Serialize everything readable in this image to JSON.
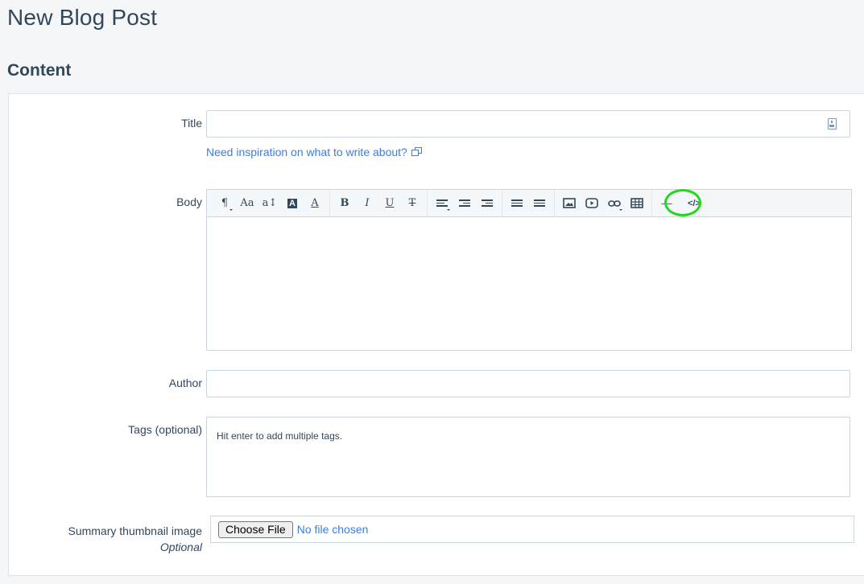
{
  "page": {
    "title": "New Blog Post"
  },
  "section": {
    "title": "Content"
  },
  "fields": {
    "title": {
      "label": "Title",
      "value": "",
      "placeholder": ""
    },
    "inspiration_link": "Need inspiration on what to write about?",
    "body": {
      "label": "Body"
    },
    "author": {
      "label": "Author",
      "value": ""
    },
    "tags": {
      "label": "Tags (optional)",
      "hint": "Hit enter to add multiple tags."
    },
    "thumbnail": {
      "label": "Summary thumbnail image",
      "optional": "Optional",
      "button": "Choose File",
      "status": "No file chosen"
    }
  },
  "toolbar": {
    "paragraph": "¶",
    "font": "Aa",
    "size": "a↕",
    "bg_color": "A",
    "text_color": "A",
    "bold": "B",
    "italic": "I",
    "underline": "U",
    "strike": "T",
    "hr": "—",
    "source": "</>"
  },
  "colors": {
    "link": "#3a7ee0",
    "highlight": "#22d81f"
  }
}
